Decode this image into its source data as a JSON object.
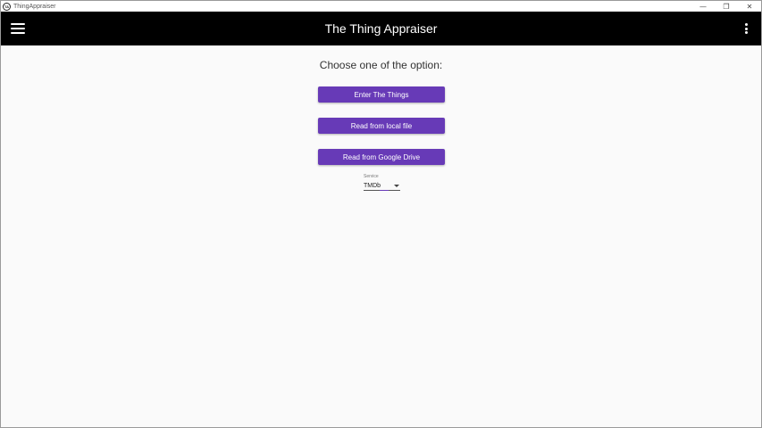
{
  "window": {
    "title": "ThingAppraiser",
    "icon_text": "TA",
    "controls": {
      "minimize": "—",
      "maximize": "❐",
      "close": "✕"
    }
  },
  "appbar": {
    "title": "The Thing Appraiser",
    "menu_icon": "hamburger-menu-icon",
    "more_icon": "more-vertical-icon"
  },
  "main": {
    "prompt": "Choose one of the option:",
    "buttons": [
      {
        "label": "Enter The Things"
      },
      {
        "label": "Read from local file"
      },
      {
        "label": "Read from Google Drive"
      }
    ],
    "service": {
      "label": "Service",
      "selected": "TMDb"
    }
  },
  "colors": {
    "accent": "#673ab7",
    "appbar_bg": "#000000",
    "page_bg": "#fafafa"
  }
}
